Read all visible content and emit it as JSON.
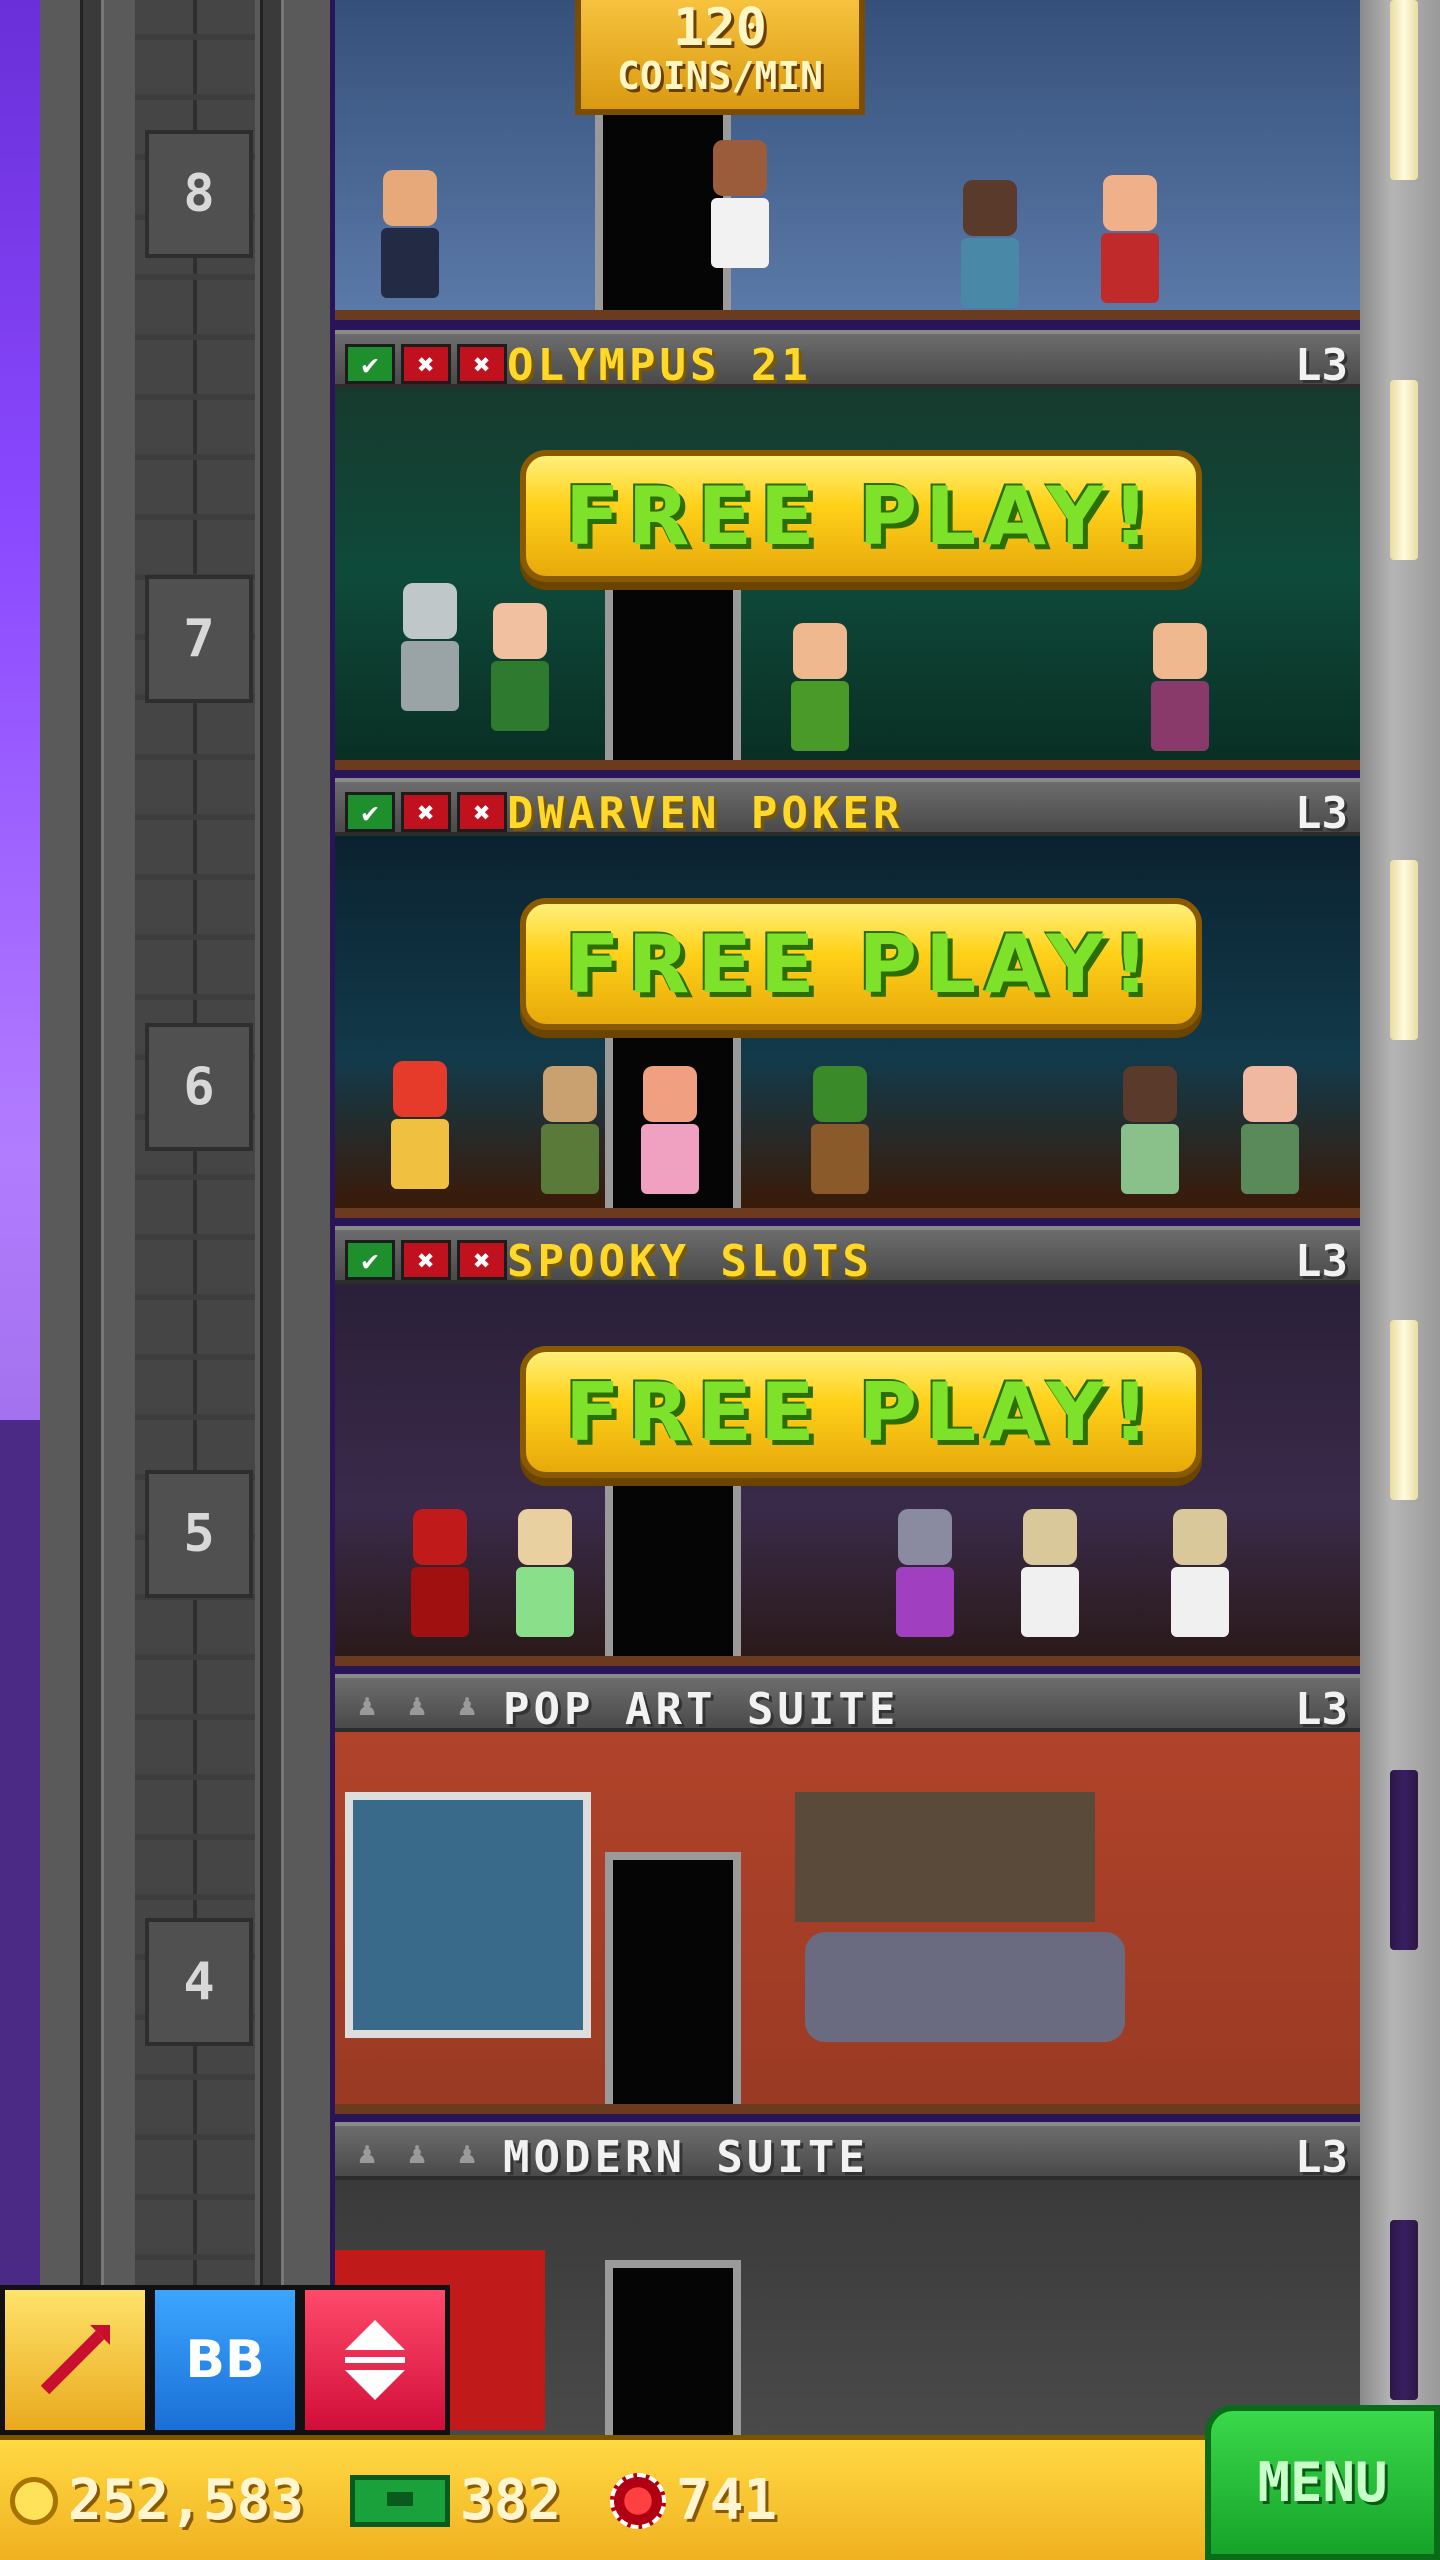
{
  "top_floor": {
    "number": "8",
    "sign_value": "120",
    "sign_label": "COINS/MIN"
  },
  "floors": [
    {
      "number": "7",
      "name": "OLYMPUS 21",
      "level": "L3",
      "stock": [
        "ok",
        "no",
        "no"
      ],
      "action": "FREE  PLAY!",
      "bg": "#0e4a3a"
    },
    {
      "number": "6",
      "name": "DWARVEN POKER",
      "level": "L3",
      "stock": [
        "ok",
        "no",
        "no"
      ],
      "action": "FREE  PLAY!",
      "bg": "#0b2230"
    },
    {
      "number": "5",
      "name": "SPOOKY SLOTS",
      "level": "L3",
      "stock": [
        "ok",
        "no",
        "no"
      ],
      "action": "FREE  PLAY!",
      "bg": "#3a2a4a"
    },
    {
      "number": "4",
      "name": "POP ART SUITE",
      "level": "L3",
      "stock": [
        "empty",
        "empty",
        "empty"
      ],
      "action": "",
      "bg": "#b0432a"
    },
    {
      "number": "",
      "name": "MODERN SUITE",
      "level": "L3",
      "stock": [
        "empty",
        "empty",
        "empty"
      ],
      "action": "",
      "bg": "#4a4a4a"
    }
  ],
  "status": {
    "coins": "252,583",
    "bux": "382",
    "chips": "741"
  },
  "toolbar": {
    "bb_label": "BB"
  },
  "menu_label": "MENU",
  "colors": {
    "gold": "#ffd829",
    "free_play_text": "#7ee22a",
    "menu_green": "#16a32a"
  },
  "icons": [
    "coin-icon",
    "bux-icon",
    "chip-icon",
    "rocket-icon",
    "elevator-icon"
  ]
}
